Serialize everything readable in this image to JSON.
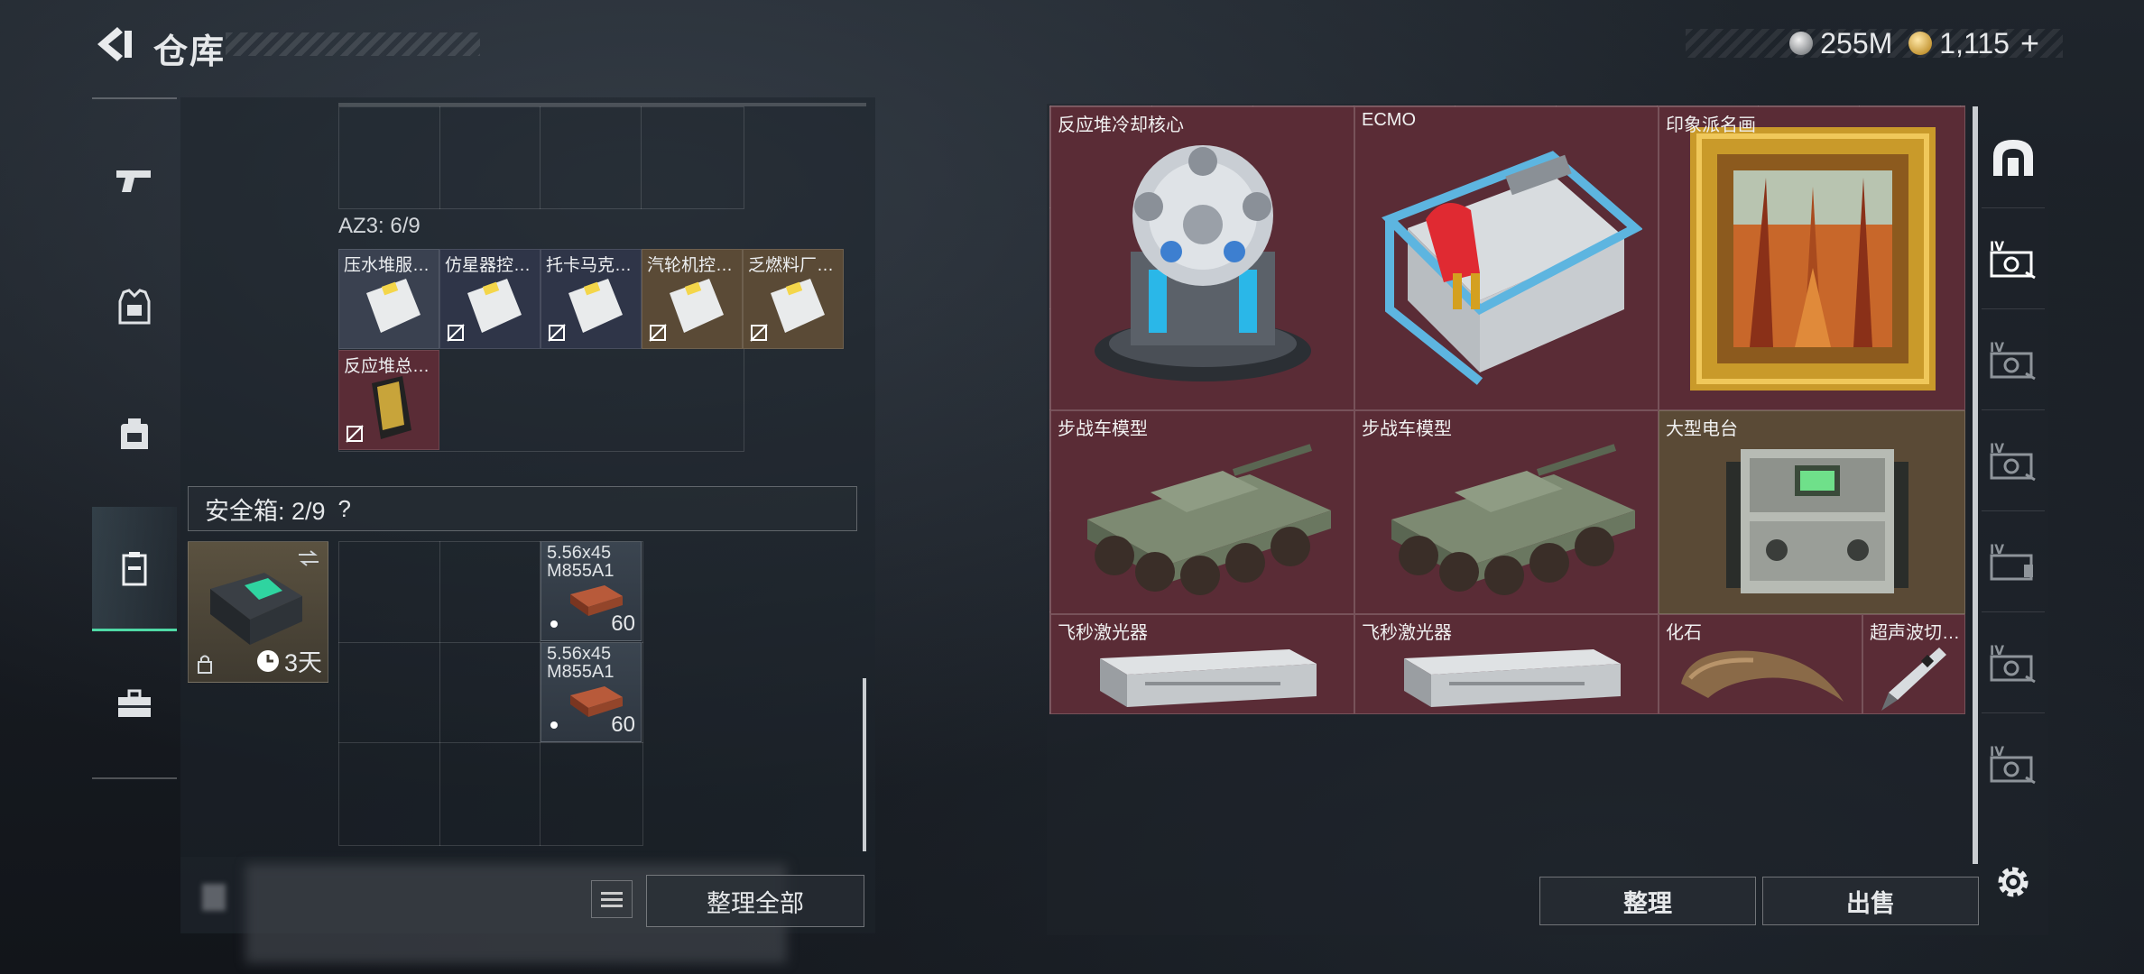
{
  "header": {
    "title": "仓库",
    "currency": [
      {
        "icon": "silver-coin-icon",
        "value": "255M"
      },
      {
        "icon": "gold-coin-icon",
        "value": "1,115"
      }
    ],
    "add_label": "+"
  },
  "left_nav": {
    "items": [
      {
        "icon": "pistol-icon"
      },
      {
        "icon": "armor-vest-icon"
      },
      {
        "icon": "backpack-icon"
      },
      {
        "icon": "safebox-icon",
        "active": true
      },
      {
        "icon": "toolbox-icon"
      }
    ]
  },
  "container": {
    "label": "AZ3: 6/9",
    "items": [
      {
        "label": "压水堆服…",
        "color": "#3a4150"
      },
      {
        "label": "仿星器控…",
        "color": "#2f3548"
      },
      {
        "label": "托卡马克…",
        "color": "#2f3548"
      },
      {
        "label": "汽轮机控…",
        "color": "#5a4a36"
      },
      {
        "label": "乏燃料厂…",
        "color": "#5a4a36"
      },
      {
        "label": "反应堆总…",
        "color": "#5a2c36"
      }
    ]
  },
  "safebox": {
    "label": "安全箱: 2/9",
    "help": "?",
    "timer": "3天",
    "ammo": [
      {
        "name": "5.56x45",
        "sub": "M855A1",
        "qty": "60"
      },
      {
        "name": "5.56x45",
        "sub": "M855A1",
        "qty": "60"
      }
    ]
  },
  "left_actions": {
    "sort_all": "整理全部"
  },
  "stash": {
    "items": [
      {
        "label": "反应堆冷却核心",
        "icon": "reactor-core-icon"
      },
      {
        "label": "ECMO",
        "icon": "ecmo-machine-icon"
      },
      {
        "label": "印象派名画",
        "icon": "framed-painting-icon"
      },
      {
        "label": "步战车模型",
        "icon": "ifv-model-icon"
      },
      {
        "label": "步战车模型",
        "icon": "ifv-model-icon"
      },
      {
        "label": "大型电台",
        "icon": "radio-station-icon"
      },
      {
        "label": "飞秒激光器",
        "icon": "laser-case-icon"
      },
      {
        "label": "飞秒激光器",
        "icon": "laser-case-icon"
      },
      {
        "label": "化石",
        "icon": "fossil-claw-icon"
      },
      {
        "label": "超声波切…",
        "icon": "ultrasonic-cutter-icon"
      }
    ]
  },
  "right_actions": {
    "sort": "整理",
    "sell": "出售"
  },
  "right_nav": {
    "items": [
      {
        "icon": "vault-arch-icon"
      },
      {
        "icon": "storage-iv-icon",
        "active": true
      },
      {
        "icon": "storage-iv-icon"
      },
      {
        "icon": "storage-iv-icon"
      },
      {
        "icon": "storage-iv-icon"
      },
      {
        "icon": "storage-iv-icon"
      },
      {
        "icon": "storage-iv-icon"
      }
    ],
    "badge": "IV"
  }
}
